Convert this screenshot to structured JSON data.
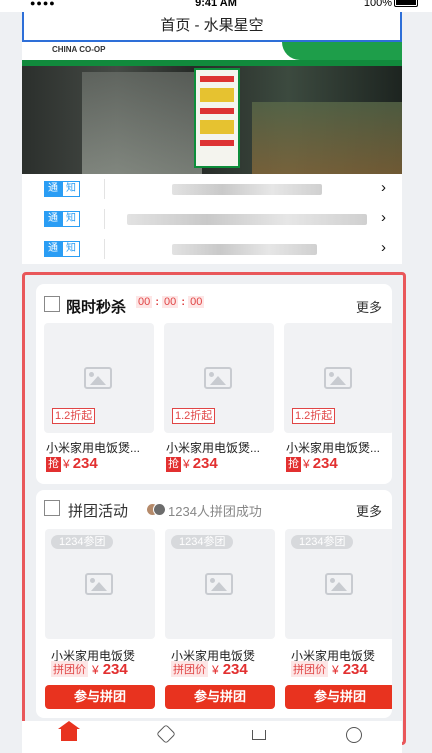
{
  "status_bar": {
    "time": "9:41 AM",
    "battery": "100%",
    "signal": "●●●●"
  },
  "nav": {
    "title": "首页 - 水果星空"
  },
  "banner": {
    "store_sign": "CHINA CO-OP"
  },
  "notices": [
    {
      "tag_left": "通",
      "tag_right": "知",
      "chevron": "›"
    },
    {
      "tag_left": "通",
      "tag_right": "知",
      "chevron": "›"
    },
    {
      "tag_left": "通",
      "tag_right": "知",
      "chevron": "›"
    }
  ],
  "flash_sale": {
    "title": "限时秒杀",
    "countdown": {
      "h": "00",
      "m": "00",
      "s": "00",
      "sep": ":"
    },
    "more": "更多",
    "products": [
      {
        "discount": "1.2折起",
        "name": "小米家用电饭煲...",
        "tag": "抢",
        "currency": "¥",
        "price": "234"
      },
      {
        "discount": "1.2折起",
        "name": "小米家用电饭煲...",
        "tag": "抢",
        "currency": "¥",
        "price": "234"
      },
      {
        "discount": "1.2折起",
        "name": "小米家用电饭煲...",
        "tag": "抢",
        "currency": "¥",
        "price": "234"
      }
    ]
  },
  "group_buy": {
    "title": "拼团活动",
    "success_text": "1234人拼团成功",
    "more": "更多",
    "products": [
      {
        "badge": "1234参团",
        "name": "小米家用电饭煲",
        "price_tag": "拼团价",
        "currency": "¥",
        "price": "234",
        "button": "参与拼团"
      },
      {
        "badge": "1234参团",
        "name": "小米家用电饭煲",
        "price_tag": "拼团价",
        "currency": "¥",
        "price": "234",
        "button": "参与拼团"
      },
      {
        "badge": "1234参团",
        "name": "小米家用电饭煲",
        "price_tag": "拼团价",
        "currency": "¥",
        "price": "234",
        "button": "参与拼团"
      }
    ]
  },
  "tabbar": {
    "accent": "#e8331f",
    "items": [
      {
        "icon": "home-icon",
        "active": true
      },
      {
        "icon": "category-icon"
      },
      {
        "icon": "cart-icon"
      },
      {
        "icon": "profile-icon"
      }
    ]
  }
}
